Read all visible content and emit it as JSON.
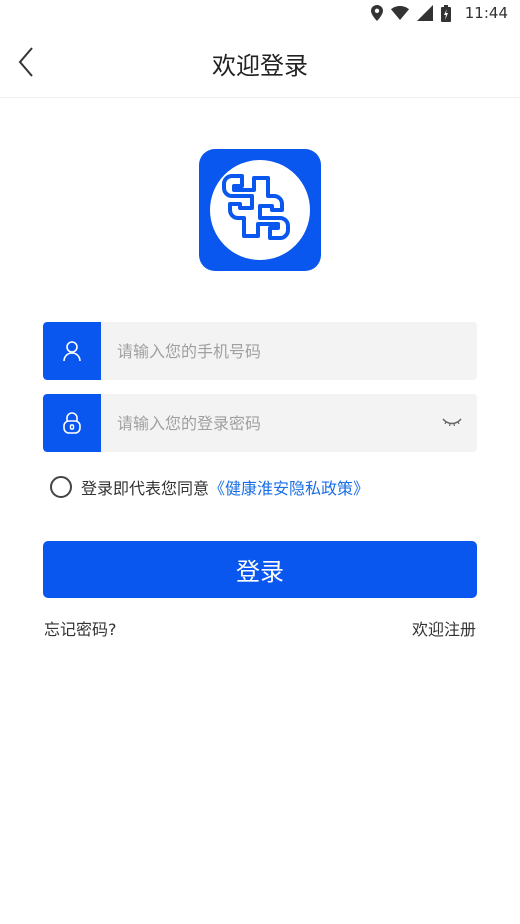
{
  "status_bar": {
    "time": "11:44",
    "icons": [
      "location-icon",
      "wifi-icon",
      "signal-icon",
      "battery-icon"
    ]
  },
  "header": {
    "title": "欢迎登录",
    "back_icon": "chevron-left-icon"
  },
  "logo": {
    "icon": "health-cross-logo"
  },
  "phone_field": {
    "placeholder": "请输入您的手机号码",
    "value": "",
    "icon": "user-icon"
  },
  "password_field": {
    "placeholder": "请输入您的登录密码",
    "value": "",
    "icon": "lock-icon",
    "toggle_icon": "eye-closed-icon"
  },
  "agreement": {
    "text": "登录即代表您同意",
    "policy_link": "《健康淮安隐私政策》",
    "checked": false
  },
  "login_button": {
    "label": "登录"
  },
  "links": {
    "forgot": "忘记密码?",
    "register": "欢迎注册"
  },
  "colors": {
    "primary": "#0a57f0",
    "link": "#1a6fe6",
    "field_bg": "#f3f3f3"
  }
}
